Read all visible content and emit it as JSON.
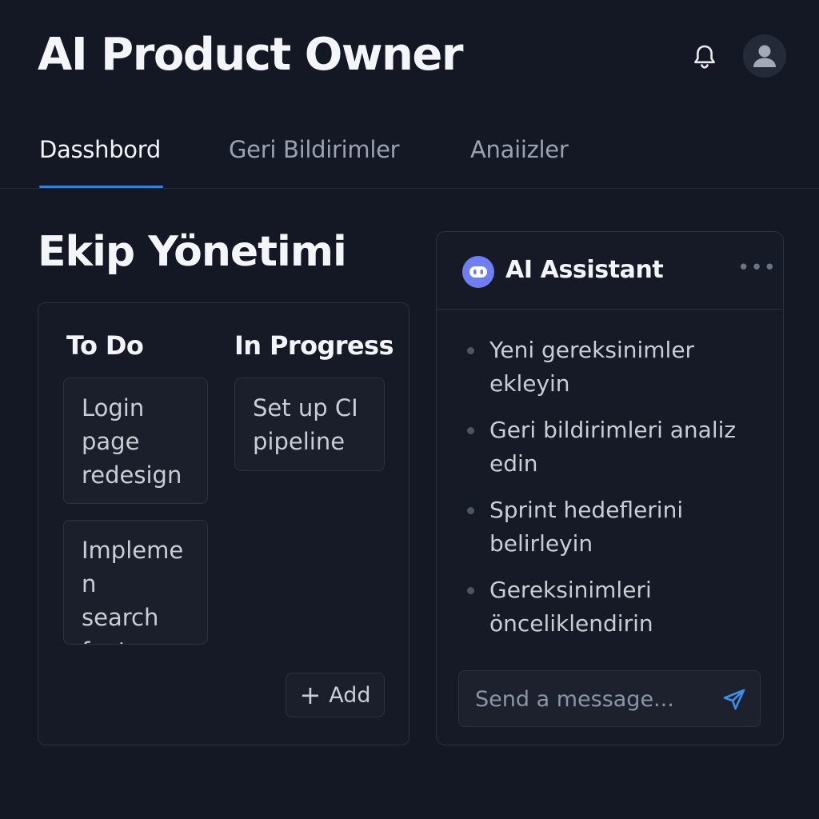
{
  "app": {
    "title": "AI Product Owner"
  },
  "header": {
    "notification_icon": "bell-icon",
    "profile_icon": "user-avatar-icon"
  },
  "tabs": [
    {
      "label": "Dasshbord",
      "active": true
    },
    {
      "label": "Geri Bildirimler",
      "active": false
    },
    {
      "label": "Anaiizler",
      "active": false
    }
  ],
  "section": {
    "title": "Ekip Yönetimi"
  },
  "board": {
    "columns": [
      {
        "title": "To Do",
        "cards": [
          {
            "text": "Login\npage\nredesign"
          },
          {
            "text": "Implemen\nsearch\nfeature"
          }
        ]
      },
      {
        "title": "In Progress",
        "cards": [
          {
            "text": "Set up CI\npipeline"
          }
        ]
      }
    ],
    "add_label": "Add"
  },
  "assistant": {
    "title": "AI Assistant",
    "more_icon": "more-horizontal-icon",
    "suggestions": [
      "Yeni gereksinimler ekleyin",
      "Geri bildirimleri analiz edin",
      "Sprint hedeflerini belirleyin",
      "Gereksinimleri önceliklendirin"
    ],
    "input_placeholder": "Send a message...",
    "send_icon": "send-icon"
  },
  "colors": {
    "background": "#141824",
    "accent": "#3f7fd3",
    "bot_icon": "#6f7ef0",
    "panel_border": "#2b303d"
  }
}
